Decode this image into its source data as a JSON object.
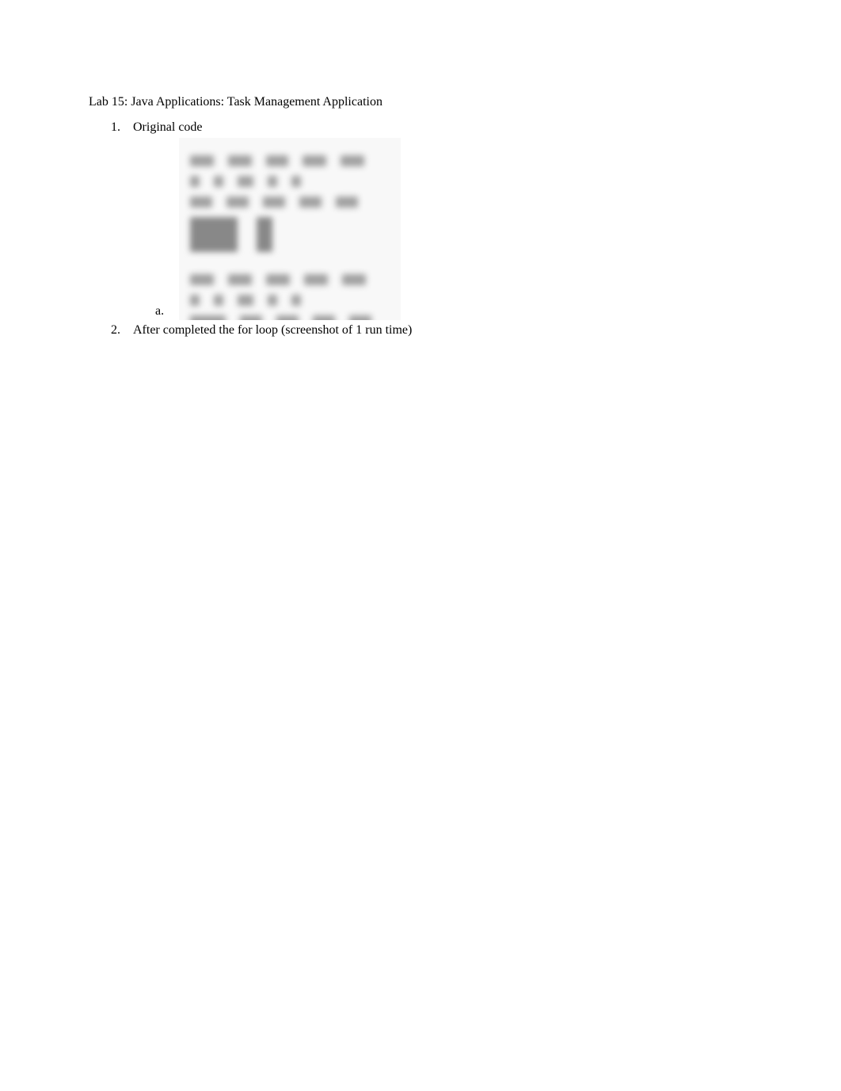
{
  "title": "Lab 15: Java Applications: Task Management Application",
  "items": [
    {
      "num": "1.",
      "text": "Original code",
      "sub": [
        {
          "num": "a."
        }
      ]
    },
    {
      "num": "2.",
      "text": "After completed the for loop (screenshot of 1 run time)"
    }
  ]
}
